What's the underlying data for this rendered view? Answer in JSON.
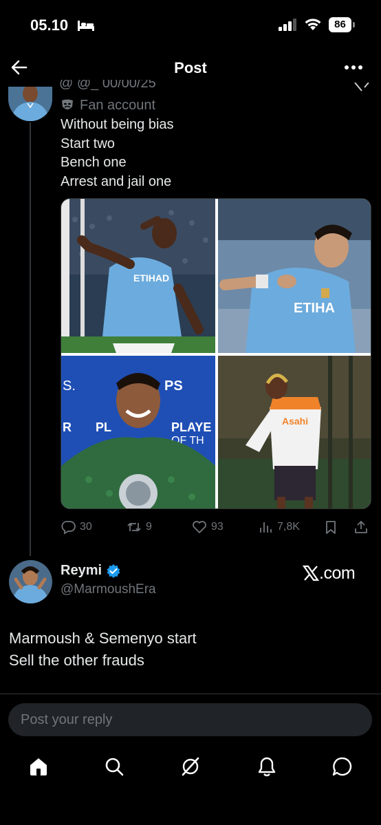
{
  "status": {
    "time": "05.10",
    "battery": "86"
  },
  "header": {
    "title": "Post"
  },
  "quoted_post": {
    "cut_name_text": "@ @_ 00/00/25",
    "fan_label": "Fan account",
    "lines": [
      "Without being bias",
      "Start two",
      "Bench one",
      "Arrest and jail one"
    ],
    "actions": {
      "replies": "30",
      "reposts": "9",
      "likes": "93",
      "views": "7,8K"
    }
  },
  "reply_post": {
    "display_name": "Reymi",
    "handle": "@MarmoushEra",
    "source": ".com",
    "lines": [
      "Marmoush & Semenyo start",
      "Sell the other frauds"
    ]
  },
  "composer": {
    "placeholder": "Post your reply"
  },
  "colors": {
    "bg": "#000000",
    "text": "#e7e9ea",
    "muted": "#71767b",
    "verified": "#1d9bf0",
    "city_blue": "#6cabdd"
  },
  "icons": [
    "bed-icon",
    "signal-icon",
    "wifi-icon",
    "back-icon",
    "more-icon",
    "mask-icon",
    "reply-icon",
    "repost-icon",
    "like-icon",
    "views-icon",
    "bookmark-icon",
    "share-icon",
    "verified-icon",
    "x-logo-icon",
    "home-icon",
    "search-icon",
    "grok-icon",
    "bell-icon",
    "message-icon"
  ]
}
